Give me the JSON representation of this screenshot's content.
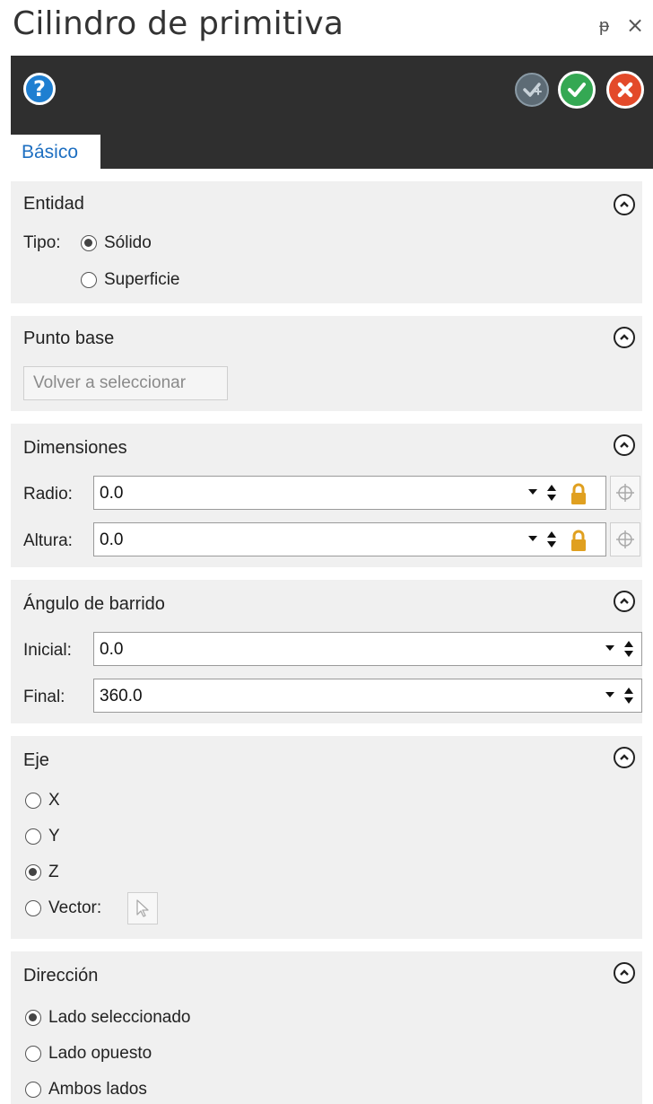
{
  "window": {
    "title": "Cilindro de primitiva",
    "pin_glyph": "ᵽ",
    "close_glyph": "×"
  },
  "toolbar": {
    "help_glyph": "?"
  },
  "tabs": [
    {
      "label": "Básico"
    }
  ],
  "entidad": {
    "title": "Entidad",
    "tipo_label": "Tipo:",
    "options": [
      {
        "label": "Sólido",
        "checked": true
      },
      {
        "label": "Superficie",
        "checked": false
      }
    ]
  },
  "punto_base": {
    "title": "Punto base",
    "reselect_label": "Volver a seleccionar"
  },
  "dimensiones": {
    "title": "Dimensiones",
    "radio_label": "Radio:",
    "radio_value": "0.0",
    "altura_label": "Altura:",
    "altura_value": "0.0"
  },
  "angulo": {
    "title": "Ángulo de barrido",
    "inicial_label": "Inicial:",
    "inicial_value": "0.0",
    "final_label": "Final:",
    "final_value": "360.0"
  },
  "eje": {
    "title": "Eje",
    "options": [
      {
        "label": "X",
        "checked": false
      },
      {
        "label": "Y",
        "checked": false
      },
      {
        "label": "Z",
        "checked": true
      },
      {
        "label": "Vector:",
        "checked": false
      }
    ]
  },
  "direccion": {
    "title": "Dirección",
    "options": [
      {
        "label": "Lado seleccionado",
        "checked": true
      },
      {
        "label": "Lado opuesto",
        "checked": false
      },
      {
        "label": "Ambos lados",
        "checked": false
      }
    ]
  },
  "colors": {
    "accent": "#1e6fc1",
    "toolbar_bg": "#2f2f2f",
    "section_bg": "#f0f0f0",
    "ok": "#34a853",
    "cancel": "#e34a2a",
    "lock": "#e0a020"
  }
}
